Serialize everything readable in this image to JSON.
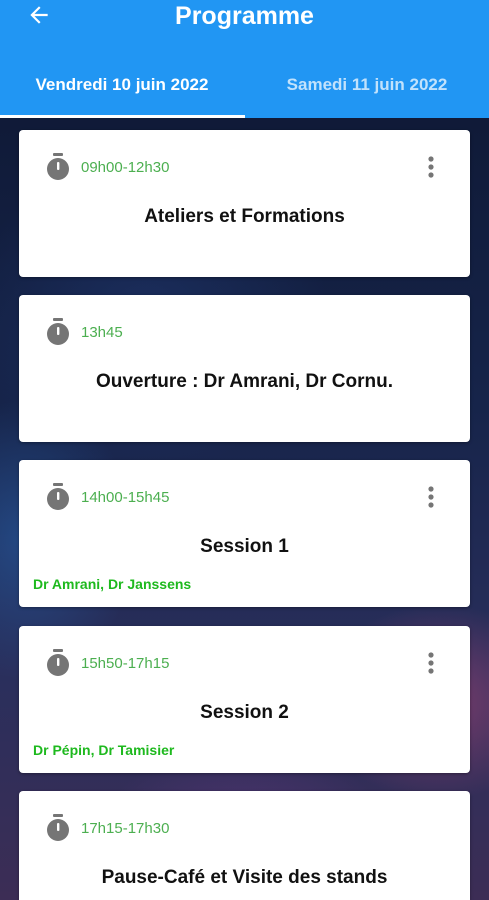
{
  "header": {
    "title": "Programme",
    "back_icon": "arrow-left-icon"
  },
  "tabs": [
    {
      "label": "Vendredi 10 juin 2022",
      "selected": true
    },
    {
      "label": "Samedi 11 juin 2022",
      "selected": false
    }
  ],
  "colors": {
    "appbar": "#2196f3",
    "time": "#4caf50",
    "speakers": "#1eb91e",
    "icon": "#757575"
  },
  "sessions": [
    {
      "time": "09h00-12h30",
      "title": "Ateliers et Formations",
      "speakers": "",
      "has_menu": true
    },
    {
      "time": "13h45",
      "title": "Ouverture : Dr Amrani, Dr Cornu.",
      "speakers": "",
      "has_menu": false
    },
    {
      "time": "14h00-15h45",
      "title": "Session 1",
      "speakers": "Dr Amrani, Dr Janssens",
      "has_menu": true
    },
    {
      "time": "15h50-17h15",
      "title": "Session 2",
      "speakers": "Dr Pépin, Dr Tamisier",
      "has_menu": true
    },
    {
      "time": "17h15-17h30",
      "title": "Pause-Café et Visite des stands",
      "speakers": "",
      "has_menu": false
    }
  ]
}
